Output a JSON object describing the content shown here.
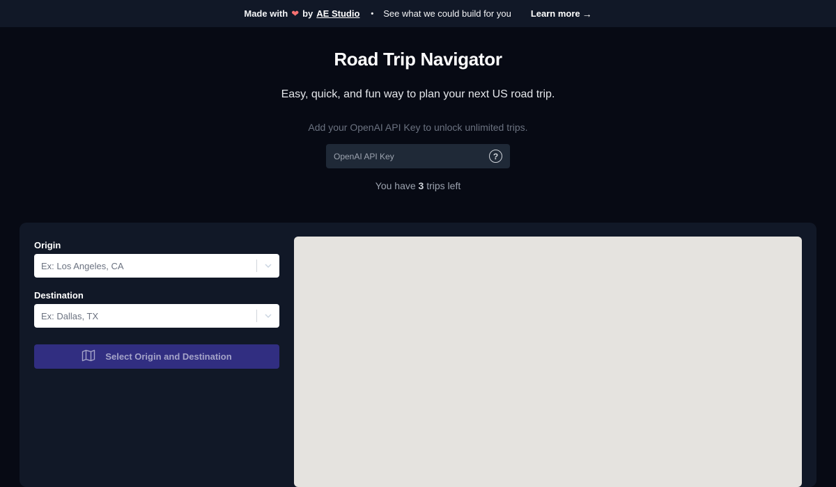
{
  "banner": {
    "made_with": "Made with",
    "by": "by",
    "studio": "AE Studio",
    "bullet": "•",
    "cta": "See what we could build for you",
    "learn_more": "Learn more",
    "arrow": "→",
    "heart_color": "#f87171"
  },
  "header": {
    "title": "Road Trip Navigator",
    "subtitle": "Easy, quick, and fun way to plan your next US road trip."
  },
  "api_key": {
    "hint": "Add your OpenAI API Key to unlock unlimited trips.",
    "placeholder": "OpenAI API Key",
    "help_glyph": "?"
  },
  "trips": {
    "prefix": "You have",
    "count": "3",
    "suffix": "trips left"
  },
  "form": {
    "origin_label": "Origin",
    "origin_placeholder": "Ex: Los Angeles, CA",
    "destination_label": "Destination",
    "destination_placeholder": "Ex: Dallas, TX",
    "submit_label": "Select Origin and Destination",
    "submit_color": "#312e81"
  },
  "map": {
    "background": "#e5e3df"
  }
}
